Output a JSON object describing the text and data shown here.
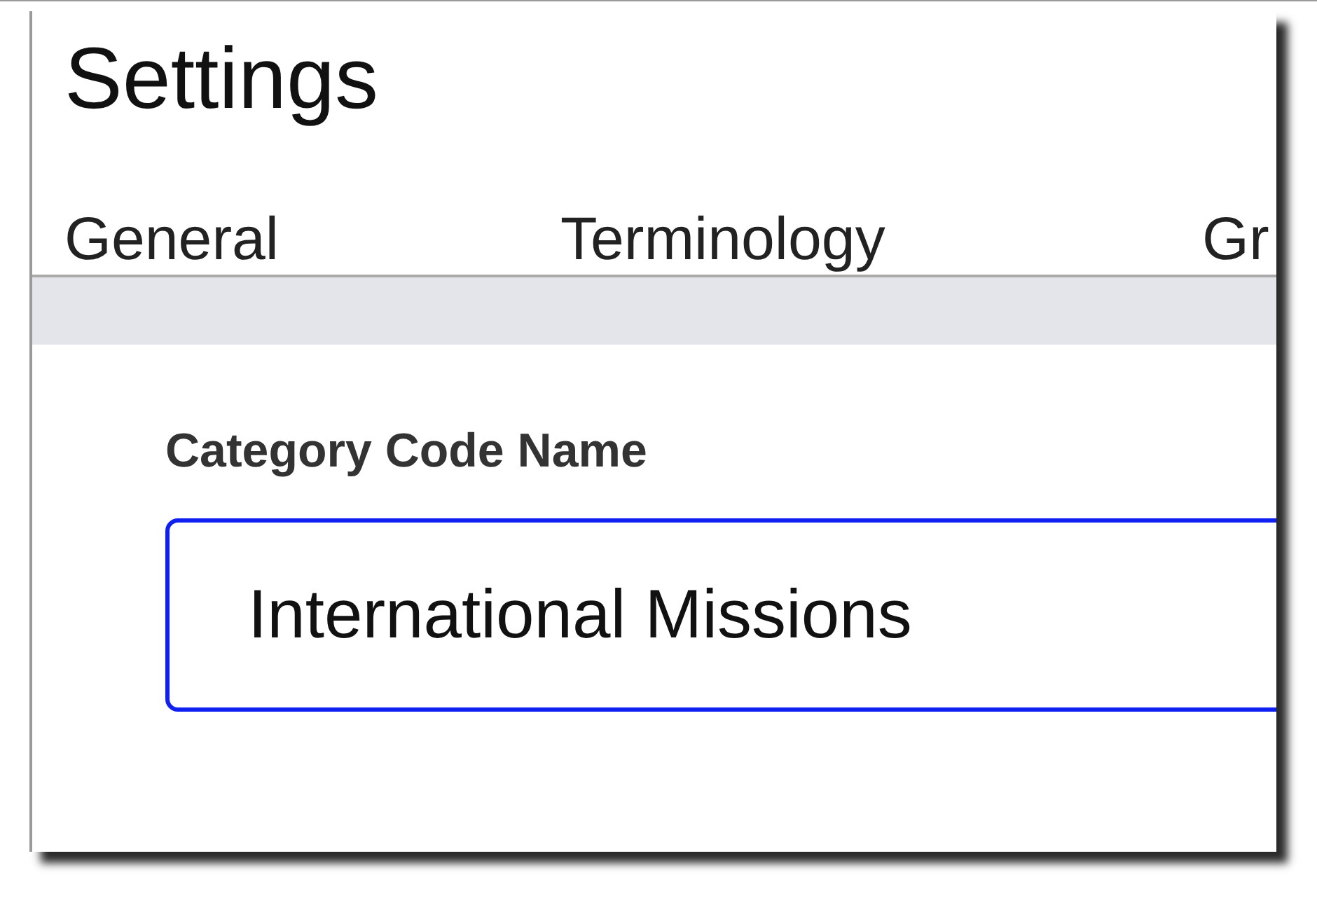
{
  "title": "Settings",
  "tabs": [
    {
      "label": "General"
    },
    {
      "label": "Terminology"
    },
    {
      "label": "Gr"
    }
  ],
  "field": {
    "label": "Category Code Name",
    "value": "International Missions"
  }
}
